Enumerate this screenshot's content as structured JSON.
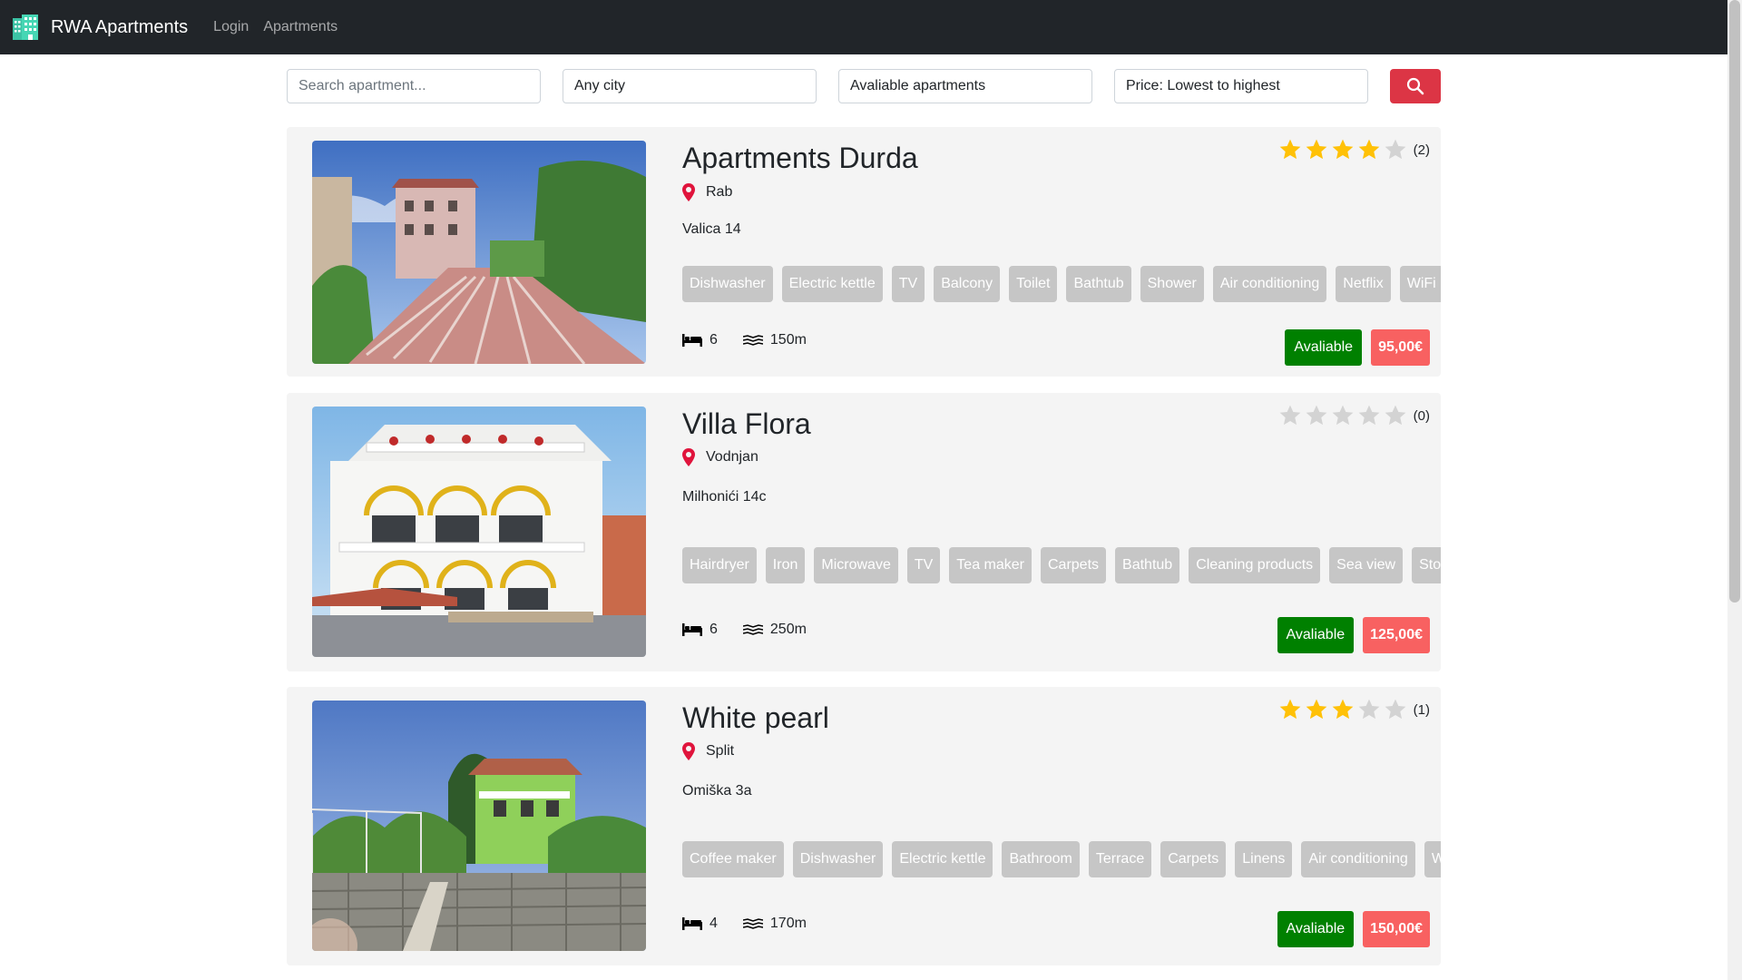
{
  "navbar": {
    "brand": "RWA Apartments",
    "links": [
      "Login",
      "Apartments"
    ]
  },
  "search": {
    "placeholder": "Search apartment...",
    "city": "Any city",
    "availability": "Avaliable apartments",
    "sort": "Price: Lowest to highest"
  },
  "colors": {
    "navbar": "#212529",
    "search_button": "#dc3545",
    "available_badge": "#008000",
    "price_badge": "#f86161",
    "star_filled": "#ffc107",
    "star_empty": "#d3d3d3",
    "tag": "#c6c6c6",
    "location_pin": "#e0143c"
  },
  "apartments": [
    {
      "name": "Apartments Durda",
      "city": "Rab",
      "address": "Valica 14",
      "rating": 4,
      "reviews": "(2)",
      "amenities": [
        "Dishwasher",
        "Electric kettle",
        "TV",
        "Balcony",
        "Toilet",
        "Bathtub",
        "Shower",
        "Air conditioning",
        "Netflix",
        "WiFi"
      ],
      "beds": "6",
      "distance": "150m",
      "status": "Avaliable",
      "price": "95,00€"
    },
    {
      "name": "Villa Flora",
      "city": "Vodnjan",
      "address": "Milhonići 14c",
      "rating": 0,
      "reviews": "(0)",
      "amenities": [
        "Hairdryer",
        "Iron",
        "Microwave",
        "TV",
        "Tea maker",
        "Carpets",
        "Bathtub",
        "Cleaning products",
        "Sea view",
        "Stove"
      ],
      "beds": "6",
      "distance": "250m",
      "status": "Avaliable",
      "price": "125,00€"
    },
    {
      "name": "White pearl",
      "city": "Split",
      "address": "Omiška 3a",
      "rating": 3,
      "reviews": "(1)",
      "amenities": [
        "Coffee maker",
        "Dishwasher",
        "Electric kettle",
        "Bathroom",
        "Terrace",
        "Carpets",
        "Linens",
        "Air conditioning",
        "WiFi"
      ],
      "beds": "4",
      "distance": "170m",
      "status": "Avaliable",
      "price": "150,00€"
    }
  ]
}
